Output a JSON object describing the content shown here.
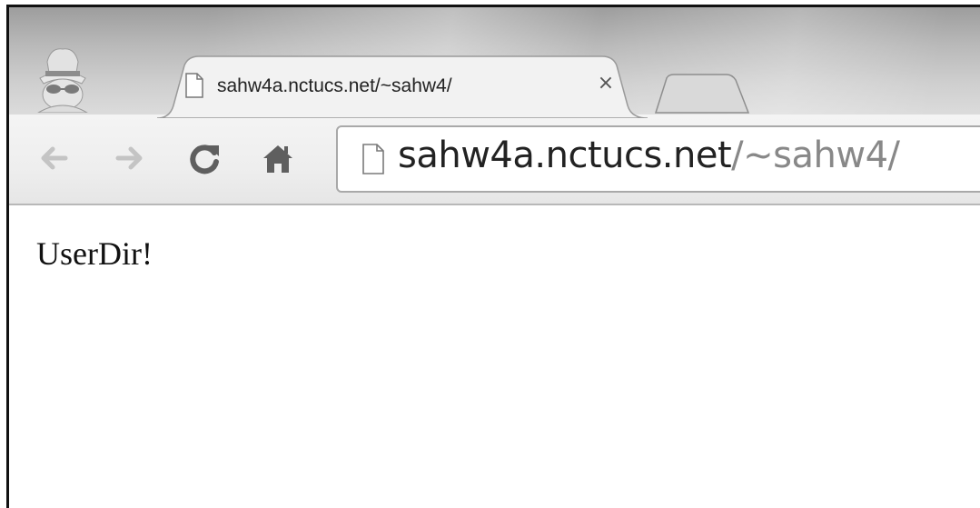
{
  "tab": {
    "title": "sahw4a.nctucs.net/~sahw4/",
    "close_glyph": "×",
    "favicon": "page-icon"
  },
  "toolbar": {
    "back_icon": "back-arrow-icon",
    "forward_icon": "forward-arrow-icon",
    "reload_icon": "reload-icon",
    "home_icon": "home-icon"
  },
  "omnibox": {
    "host": "sahw4a.nctucs.net",
    "path": "/~sahw4/",
    "icon": "page-icon"
  },
  "page": {
    "body_text": "UserDir!"
  },
  "window": {
    "incognito_icon": "incognito-icon"
  }
}
